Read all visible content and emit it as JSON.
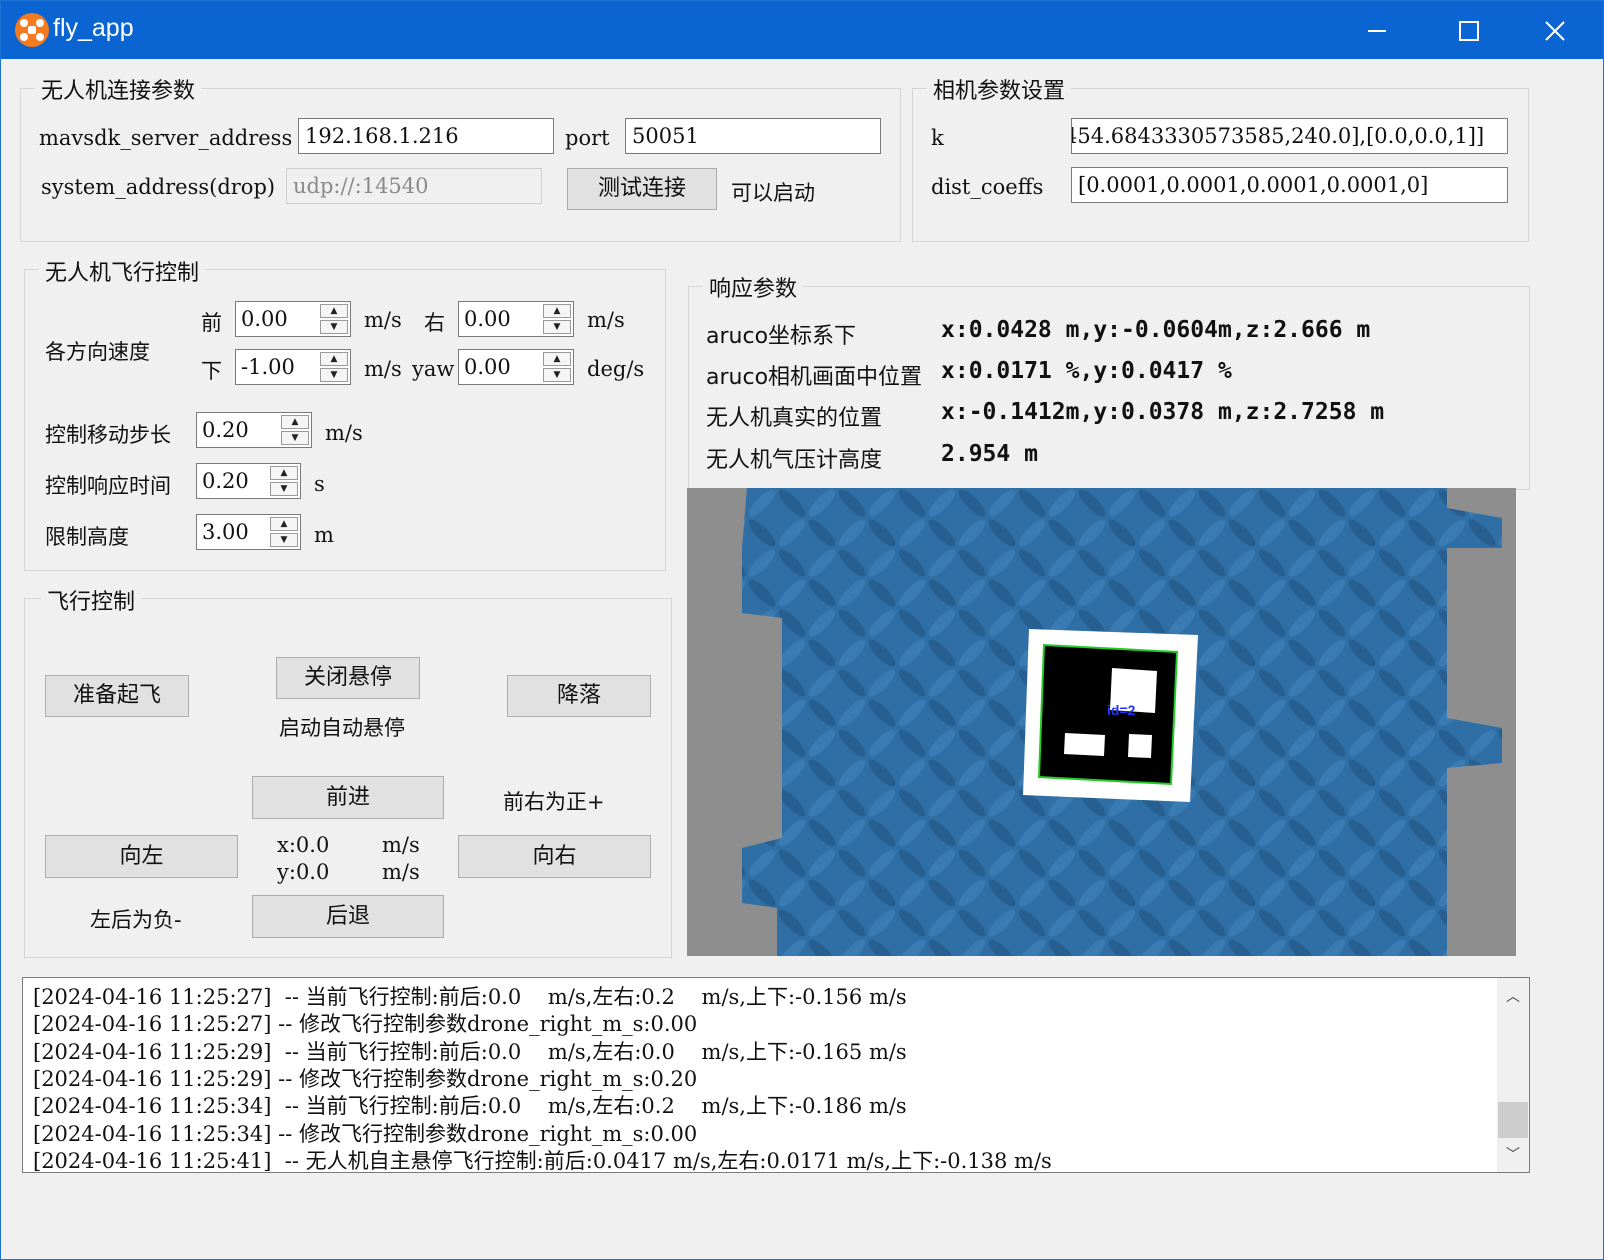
{
  "window": {
    "title": "fly_app"
  },
  "connection": {
    "group_title": "无人机连接参数",
    "server_label": "mavsdk_server_address",
    "server_value": "192.168.1.216",
    "port_label": "port",
    "port_value": "50051",
    "system_label": "system_address(drop)",
    "system_placeholder": "udp://:14540",
    "test_button": "测试连接",
    "status": "可以启动"
  },
  "camera": {
    "group_title": "相机参数设置",
    "k_label": "k",
    "k_value": "454.6843330573585,240.0],[0.0,0.0,1]]",
    "dist_label": "dist_coeffs",
    "dist_value": "[0.0001,0.0001,0.0001,0.0001,0]"
  },
  "flight_params": {
    "group_title": "无人机飞行控制",
    "speed_label": "各方向速度",
    "front_label": "前",
    "front_value": "0.00",
    "front_unit": "m/s",
    "right_label": "右",
    "right_value": "0.00",
    "right_unit": "m/s",
    "down_label": "下",
    "down_value": "-1.00",
    "down_unit": "m/s",
    "yaw_label": "yaw",
    "yaw_value": "0.00",
    "yaw_unit": "deg/s",
    "step_label": "控制移动步长",
    "step_value": "0.20",
    "step_unit": "m/s",
    "resp_label": "控制响应时间",
    "resp_value": "0.20",
    "resp_unit": "s",
    "height_label": "限制高度",
    "height_value": "3.00",
    "height_unit": "m"
  },
  "flight_control": {
    "group_title": "飞行控制",
    "takeoff": "准备起飞",
    "hover_off": "关闭悬停",
    "hover_status": "启动自动悬停",
    "land": "降落",
    "forward": "前进",
    "positive_note": "前右为正+",
    "left": "向左",
    "x_readout": "x:0.0",
    "x_unit": "m/s",
    "y_readout": "y:0.0",
    "y_unit": "m/s",
    "right": "向右",
    "negative_note": "左后为负-",
    "back": "后退"
  },
  "response": {
    "group_title": "响应参数",
    "rows": [
      {
        "label": "aruco坐标系下",
        "value": "x:0.0428 m,y:-0.0604m,z:2.666  m"
      },
      {
        "label": "aruco相机画面中位置",
        "value": "x:0.0171 %,y:0.0417 %"
      },
      {
        "label": "无人机真实的位置",
        "value": "x:-0.1412m,y:0.0378 m,z:2.7258 m"
      },
      {
        "label": "无人机气压计高度",
        "value": "2.954  m"
      }
    ],
    "marker_label": "id=2"
  },
  "log": {
    "lines": [
      "[2024-04-16 11:25:27]  -- 当前飞行控制:前后:0.0    m/s,左右:0.2    m/s,上下:-0.156 m/s",
      "[2024-04-16 11:25:27] -- 修改飞行控制参数drone_right_m_s:0.00",
      "[2024-04-16 11:25:29]  -- 当前飞行控制:前后:0.0    m/s,左右:0.0    m/s,上下:-0.165 m/s",
      "[2024-04-16 11:25:29] -- 修改飞行控制参数drone_right_m_s:0.20",
      "[2024-04-16 11:25:34]  -- 当前飞行控制:前后:0.0    m/s,左右:0.2    m/s,上下:-0.186 m/s",
      "[2024-04-16 11:25:34] -- 修改飞行控制参数drone_right_m_s:0.00",
      "[2024-04-16 11:25:41]  -- 无人机自主悬停飞行控制:前后:0.0417 m/s,左右:0.0171 m/s,上下:-0.138 m/s"
    ]
  },
  "colors": {
    "titlebar": "#0a64d2",
    "accent": "#f47b20",
    "camera_blue": "#2d6ea6"
  }
}
